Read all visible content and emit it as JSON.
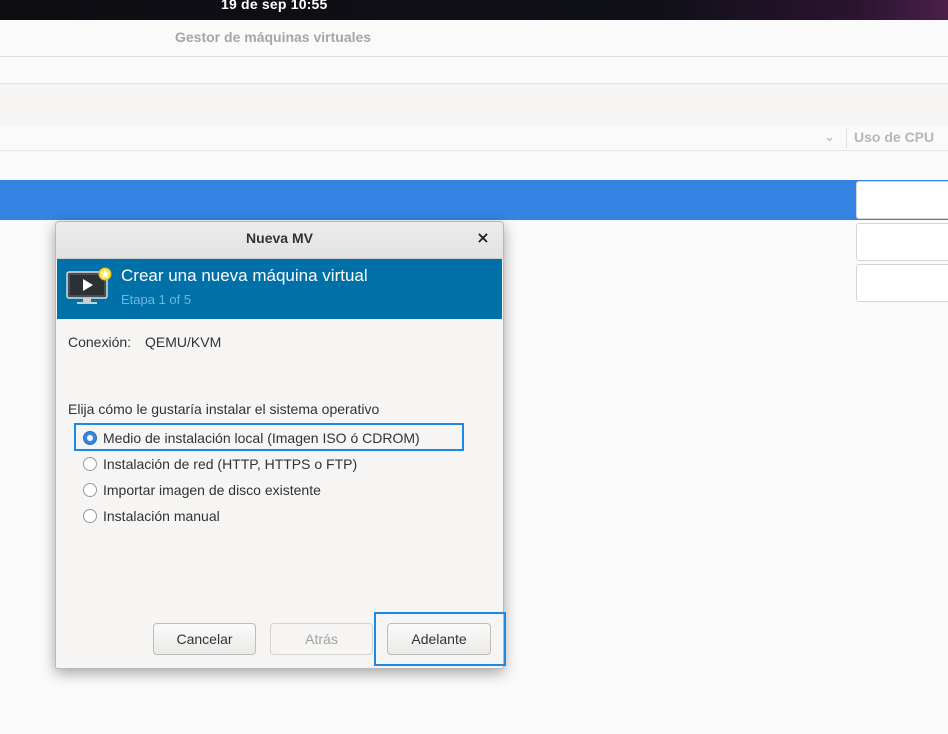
{
  "system": {
    "clock": "19 de sep  10:55"
  },
  "app": {
    "title": "Gestor de máquinas virtuales"
  },
  "vm_list": {
    "column_cpu": "Uso de CPU",
    "selection_color": "#3584e4"
  },
  "dialog": {
    "title": "Nueva MV",
    "close_label": "×",
    "banner": {
      "title": "Crear una nueva máquina virtual",
      "step": "Etapa 1 of 5",
      "background": "#0070a8",
      "icon": "monitor-play-icon"
    },
    "connection": {
      "label": "Conexión:",
      "value": "QEMU/KVM"
    },
    "prompt": "Elija cómo le gustaría instalar el sistema operativo",
    "options": [
      {
        "label": "Medio de instalación local (Imagen ISO ó CDROM)",
        "checked": true
      },
      {
        "label": "Instalación de red (HTTP, HTTPS o FTP)",
        "checked": false
      },
      {
        "label": "Importar imagen de disco existente",
        "checked": false
      },
      {
        "label": "Instalación manual",
        "checked": false
      }
    ],
    "buttons": {
      "cancel": "Cancelar",
      "back": "Atrás",
      "forward": "Adelante"
    },
    "highlight_color": "#1e88e5"
  }
}
